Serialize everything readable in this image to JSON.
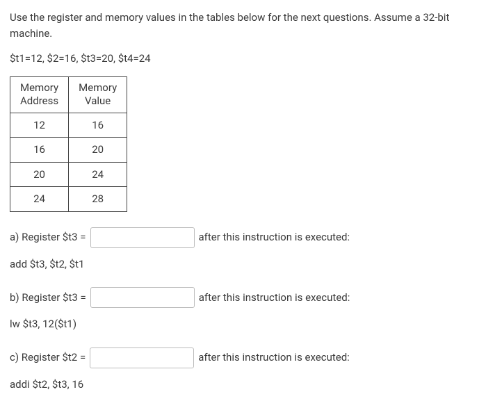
{
  "intro": "Use the register and memory values in the tables below for the next questions. Assume a 32-bit machine.",
  "registers_line": "$t1=12, $2=16, $t3=20, $t4=24",
  "table": {
    "headers": {
      "col1_l1": "Memory",
      "col1_l2": "Address",
      "col2_l1": "Memory",
      "col2_l2": "Value"
    },
    "rows": [
      {
        "addr": "12",
        "val": "16"
      },
      {
        "addr": "16",
        "val": "20"
      },
      {
        "addr": "20",
        "val": "24"
      },
      {
        "addr": "24",
        "val": "28"
      }
    ]
  },
  "questions": {
    "a": {
      "prefix": "a) Register $t3 =",
      "suffix": "after this instruction is executed:",
      "instruction": "add $t3, $t2, $t1"
    },
    "b": {
      "prefix": "b) Register $t3 =",
      "suffix": "after this instruction is executed:",
      "instruction": "lw $t3, 12($t1)"
    },
    "c": {
      "prefix": "c) Register $t2 =",
      "suffix": "after this instruction is executed:",
      "instruction": "addi $t2, $t3, 16"
    }
  }
}
